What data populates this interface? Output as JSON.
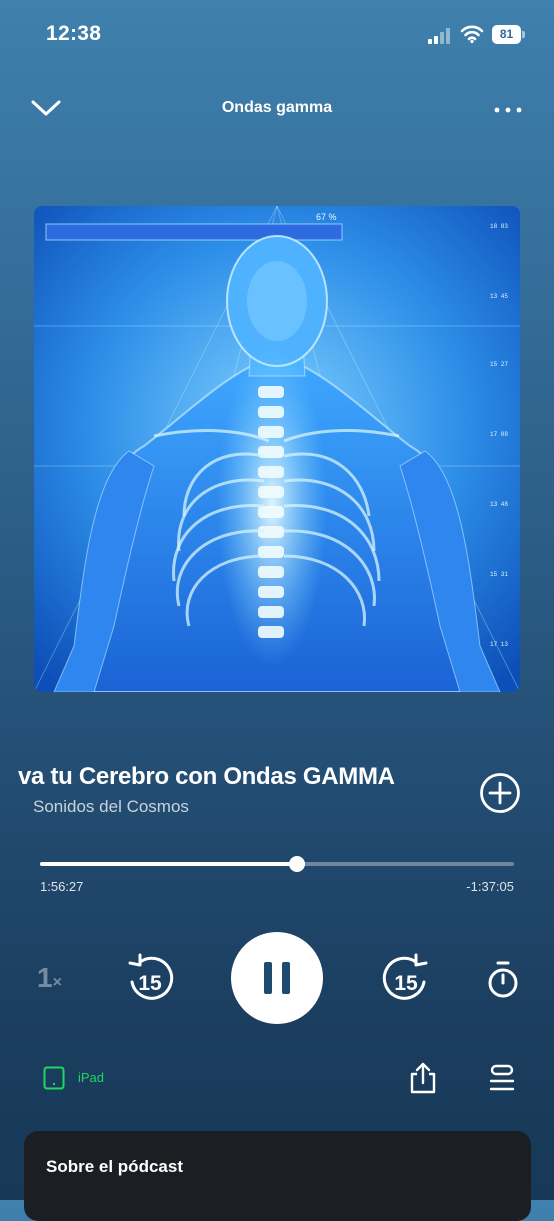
{
  "status_bar": {
    "time": "12:38",
    "battery": "81"
  },
  "header": {
    "title": "Ondas gamma"
  },
  "track": {
    "title": "va tu Cerebro con Ondas GAMMA",
    "artist": "Sonidos del Cosmos",
    "artwork_overlay_text": "67 %"
  },
  "progress": {
    "elapsed": "1:56:27",
    "remaining": "-1:37:05",
    "fraction": 0.543
  },
  "controls": {
    "speed_value": "1",
    "speed_unit": "×",
    "skip_back": "15",
    "skip_forward": "15"
  },
  "device": {
    "label": "iPad"
  },
  "about": {
    "title": "Sobre el pódcast"
  },
  "icons": [
    "cellular-signal-icon",
    "wifi-icon",
    "battery-icon",
    "chevron-down-icon",
    "more-icon",
    "add-icon",
    "rewind-15-icon",
    "pause-icon",
    "forward-15-icon",
    "sleep-timer-icon",
    "tablet-icon",
    "share-icon",
    "queue-icon"
  ],
  "colors": {
    "accent": "#1ed760",
    "background_top": "#3f80ad",
    "background_bottom": "#173856"
  }
}
